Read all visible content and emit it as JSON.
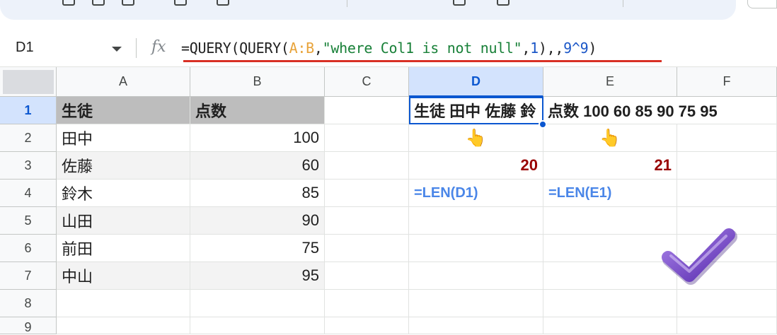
{
  "name_box": "D1",
  "formula": {
    "p1": "=QUERY(QUERY(",
    "range": "A:B",
    "p2": ",",
    "str": "\"where Col1 is not null\"",
    "p3": ",",
    "n1": "1",
    "p4": "),,",
    "n2": "9^9",
    "p5": ")"
  },
  "columns": [
    "A",
    "B",
    "C",
    "D",
    "E",
    "F"
  ],
  "rows": [
    "1",
    "2",
    "3",
    "4",
    "5",
    "6",
    "7",
    "8",
    "9"
  ],
  "cells": {
    "A1": "生徒",
    "B1": "点数",
    "A2": "田中",
    "B2": "100",
    "A3": "佐藤",
    "B3": "60",
    "A4": "鈴木",
    "B4": "85",
    "A5": "山田",
    "B5": "90",
    "A6": "前田",
    "B6": "75",
    "A7": "中山",
    "B7": "95",
    "D1": "生徒 田中 佐藤 鈴",
    "E1": "点数 100 60 85 90 75 95",
    "D2": "👆",
    "E2": "👆",
    "D3": "20",
    "E3": "21",
    "D4": "=LEN(D1)",
    "E4": "=LEN(E1)"
  },
  "icons": {
    "fx": "fx",
    "name_box_dropdown": "chevron-down-icon",
    "pointing": "pointing-up-hand-icon",
    "check": "checkmark-icon"
  },
  "colors": {
    "range": "#e8a33a",
    "string": "#188038",
    "number": "#1a56c7",
    "underline": "#d93025",
    "len_result": "#990000",
    "len_formula": "#4a86e8",
    "check": "#7b4fcf"
  }
}
